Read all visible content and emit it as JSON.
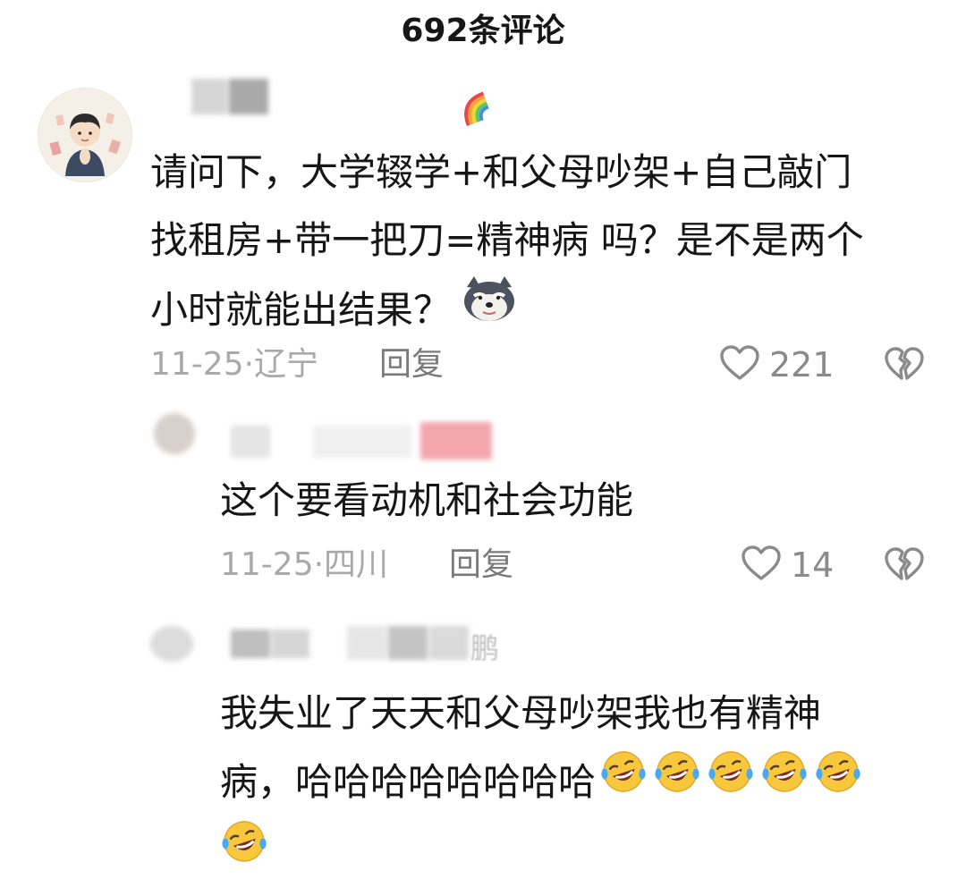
{
  "header": {
    "title": "692条评论"
  },
  "comments": [
    {
      "text_line1": "请问下，大学辍学+和父母吵架+自己敲门",
      "text_line2": "找租房+带一把刀=精神病 吗？是不是两个",
      "text_line3": "小时就能出结果？",
      "date": "11-25·辽宁",
      "reply_label": "回复",
      "likes": "221",
      "username_emoji": "rainbow",
      "trailing_emoji": "husky-doge"
    },
    {
      "text": "这个要看动机和社会功能",
      "date": "11-25·四川",
      "reply_label": "回复",
      "likes": "14"
    },
    {
      "text_line1": "我失业了天天和父母吵架我也有精神",
      "text_line2": "病，哈哈哈哈哈哈哈哈",
      "username_partial": "鹏",
      "trailing_emoji": "tears-of-joy"
    }
  ],
  "colors": {
    "text": "#161616",
    "meta": "#a3a3a3",
    "reply": "#7a7a7a",
    "icon": "#8a8a8a"
  }
}
